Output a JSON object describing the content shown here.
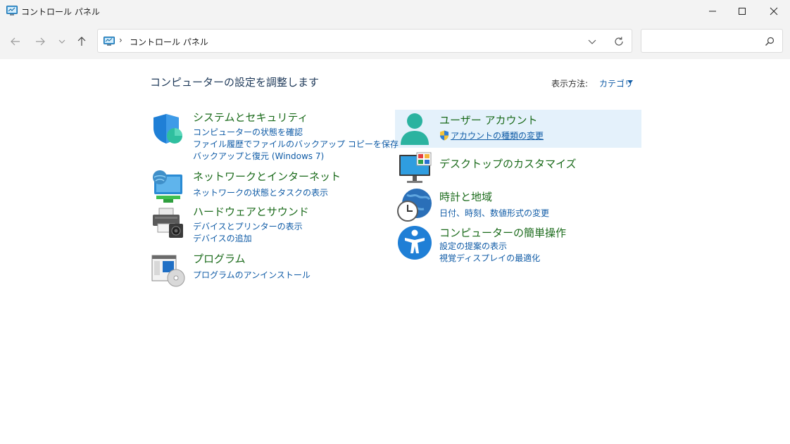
{
  "window": {
    "title": "コントロール パネル"
  },
  "address": {
    "crumb": "コントロール パネル",
    "separator": "›",
    "search_placeholder": ""
  },
  "main": {
    "title": "コンピューターの設定を調整します",
    "view_by_label": "表示方法:",
    "view_by_value": "カテゴリ"
  },
  "categories": [
    {
      "title": "システムとセキュリティ",
      "icon": "shield-icon",
      "links": [
        "コンピューターの状態を確認",
        "ファイル履歴でファイルのバックアップ コピーを保存",
        "バックアップと復元 (Windows 7)"
      ]
    },
    {
      "title": "ネットワークとインターネット",
      "icon": "network-icon",
      "links": [
        "ネットワークの状態とタスクの表示"
      ]
    },
    {
      "title": "ハードウェアとサウンド",
      "icon": "printer-icon",
      "links": [
        "デバイスとプリンターの表示",
        "デバイスの追加"
      ]
    },
    {
      "title": "プログラム",
      "icon": "programs-icon",
      "links": [
        "プログラムのアンインストール"
      ]
    },
    {
      "title": "ユーザー アカウント",
      "icon": "user-icon",
      "links": [
        "アカウントの種類の変更"
      ]
    },
    {
      "title": "デスクトップのカスタマイズ",
      "icon": "desktop-icon",
      "links": []
    },
    {
      "title": "時計と地域",
      "icon": "clock-globe-icon",
      "links": [
        "日付、時刻、数値形式の変更"
      ]
    },
    {
      "title": "コンピューターの簡単操作",
      "icon": "accessibility-icon",
      "links": [
        "設定の提案の表示",
        "視覚ディスプレイの最適化"
      ]
    }
  ],
  "colors": {
    "titlebar": "#f3f3f3",
    "category_title": "#1a6a1a",
    "link": "#0f5ba6",
    "highlight": "#e4f1fb"
  }
}
